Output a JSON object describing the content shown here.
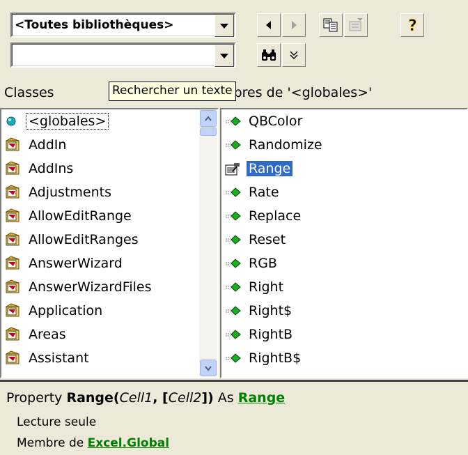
{
  "toolbar": {
    "library_combo_value": "<Toutes bibliothèques>",
    "search_combo_value": "",
    "back_icon": "back-arrow-icon",
    "forward_icon": "forward-arrow-icon",
    "copy_icon": "copy-icon",
    "view_definition_icon": "view-definition-icon",
    "help_icon": "help-icon",
    "search_icon": "binoculars-icon",
    "toggle_results_icon": "chevron-down-icon"
  },
  "tooltip": "Rechercher un texte",
  "classes_header": "Classes",
  "members_header": "Membres de '<globales>'",
  "classes": [
    {
      "label": "<globales>",
      "icon": "globals-icon"
    },
    {
      "label": "AddIn",
      "icon": "class-icon"
    },
    {
      "label": "AddIns",
      "icon": "class-icon"
    },
    {
      "label": "Adjustments",
      "icon": "class-icon"
    },
    {
      "label": "AllowEditRange",
      "icon": "class-icon"
    },
    {
      "label": "AllowEditRanges",
      "icon": "class-icon"
    },
    {
      "label": "AnswerWizard",
      "icon": "class-icon"
    },
    {
      "label": "AnswerWizardFiles",
      "icon": "class-icon"
    },
    {
      "label": "Application",
      "icon": "class-icon"
    },
    {
      "label": "Areas",
      "icon": "class-icon"
    },
    {
      "label": "Assistant",
      "icon": "class-icon"
    }
  ],
  "members": [
    {
      "label": "QBColor",
      "icon": "method-icon"
    },
    {
      "label": "Randomize",
      "icon": "method-icon"
    },
    {
      "label": "Range",
      "icon": "property-icon"
    },
    {
      "label": "Rate",
      "icon": "method-icon"
    },
    {
      "label": "Replace",
      "icon": "method-icon"
    },
    {
      "label": "Reset",
      "icon": "method-icon"
    },
    {
      "label": "RGB",
      "icon": "method-icon"
    },
    {
      "label": "Right",
      "icon": "method-icon"
    },
    {
      "label": "Right$",
      "icon": "method-icon"
    },
    {
      "label": "RightB",
      "icon": "method-icon"
    },
    {
      "label": "RightB$",
      "icon": "method-icon"
    }
  ],
  "details": {
    "kind": "Property",
    "name": "Range(",
    "param1": "Cell1",
    "sep": ", [",
    "param2": "Cell2",
    "close": "])",
    "as": " As ",
    "type_link": "Range",
    "readonly": "Lecture seule",
    "member_of": "Membre de ",
    "lib_link": "Excel",
    "dot": ".",
    "class_link": "Global"
  },
  "colors": {
    "selection": "#316ac5",
    "link": "#008000",
    "tooltip_bg": "#ffffe1"
  }
}
